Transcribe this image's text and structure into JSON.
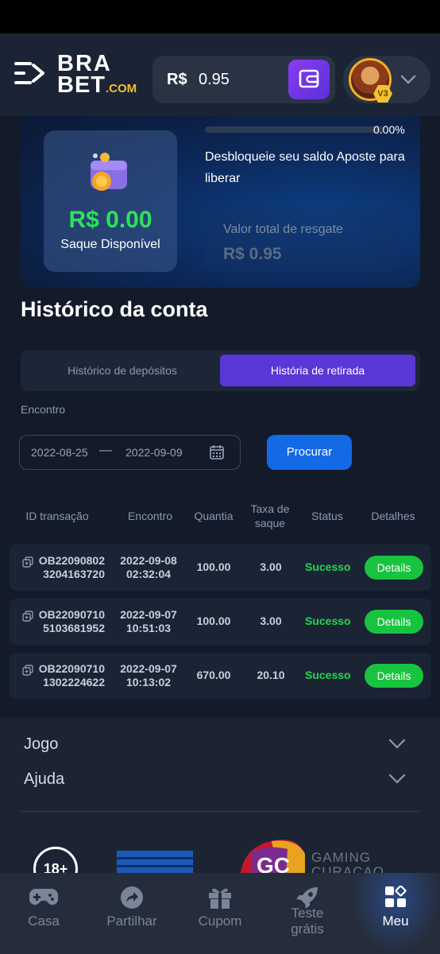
{
  "header": {
    "logo_line1_a": "BRA",
    "logo_line2_a": "BET",
    "logo_line2_b": ".COM",
    "currency": "R$",
    "balance": "0.95",
    "vip_level": "V3"
  },
  "bonus_card": {
    "progress_percent": "0.00%",
    "progress_fraction": 0.0,
    "available_value": "R$ 0.00",
    "available_label": "Saque Disponível",
    "unlock_text": "Desbloqueie seu saldo Aposte para liberar",
    "total_label": "Valor total de resgate",
    "total_value": "R$ 0.95"
  },
  "history": {
    "title": "Histórico da conta",
    "tab_deposits": "Histórico de depósitos",
    "tab_withdrawals": "História de retirada",
    "date_label": "Encontro",
    "date_from": "2022-08-25",
    "date_separator": "—",
    "date_to": "2022-09-09",
    "search_label": "Procurar"
  },
  "table": {
    "headers": [
      "ID transação",
      "Encontro",
      "Quantia",
      "Taxa de saque",
      "Status",
      "Detalhes"
    ],
    "header_taxa_l1": "Taxa de",
    "header_taxa_l2": "saque",
    "rows": [
      {
        "id_l1": "OB22090802",
        "id_l2": "3204163720",
        "date": "2022-09-08",
        "time": "02:32:04",
        "amount": "100.00",
        "fee": "3.00",
        "status": "Sucesso",
        "details": "Details"
      },
      {
        "id_l1": "OB22090710",
        "id_l2": "5103681952",
        "date": "2022-09-07",
        "time": "10:51:03",
        "amount": "100.00",
        "fee": "3.00",
        "status": "Sucesso",
        "details": "Details"
      },
      {
        "id_l1": "OB22090710",
        "id_l2": "1302224622",
        "date": "2022-09-07",
        "time": "10:13:02",
        "amount": "670.00",
        "fee": "20.10",
        "status": "Sucesso",
        "details": "Details"
      }
    ]
  },
  "footer": {
    "jogo": "Jogo",
    "ajuda": "Ajuda",
    "age": "18+",
    "gc": "GC",
    "gc_text_l1": "GAMING",
    "gc_text_l2": "CURAÇAO"
  },
  "nav": {
    "casa": "Casa",
    "partilhar": "Partilhar",
    "cupom": "Cupom",
    "teste_l1": "Teste",
    "teste_l2": "grátis",
    "meu": "Meu"
  },
  "colors": {
    "accent_purple": "#5a37d6",
    "search_blue": "#1469e5",
    "success_green": "#22d84a",
    "logo_yellow": "#f2c230"
  }
}
